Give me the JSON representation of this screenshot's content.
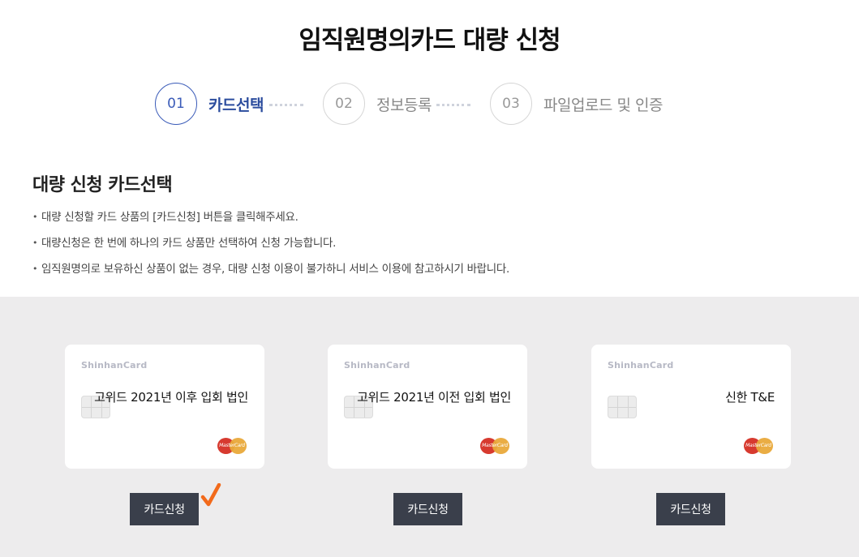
{
  "page": {
    "title": "임직원명의카드 대량 신청"
  },
  "steps": [
    {
      "number": "01",
      "label": "카드선택",
      "active": true
    },
    {
      "number": "02",
      "label": "정보등록",
      "active": false
    },
    {
      "number": "03",
      "label": "파일업로드 및 인증",
      "active": false
    }
  ],
  "section": {
    "title": "대량 신청 카드선택",
    "guides": [
      "대량 신청할 카드 상품의 [카드신청] 버튼을 클릭해주세요.",
      "대량신청은 한 번에 하나의 카드 상품만 선택하여 신청 가능합니다.",
      "임직원명의로 보유하신 상품이 없는 경우, 대량 신청 이용이 불가하니 서비스 이용에 참고하시기 바랍니다."
    ]
  },
  "cards": [
    {
      "brand": "ShinhanCard",
      "name": "고위드 2021년 이후 입회 법인",
      "network": "MasterCard",
      "button_label": "카드신청"
    },
    {
      "brand": "ShinhanCard",
      "name": "고위드 2021년 이전 입회 법인",
      "network": "MasterCard",
      "button_label": "카드신청"
    },
    {
      "brand": "ShinhanCard",
      "name": "신한 T&E",
      "network": "MasterCard",
      "button_label": "카드신청"
    }
  ],
  "icons": {
    "chip": "card-chip-icon",
    "network": "mastercard-logo-icon",
    "annotation": "check-mark-icon"
  },
  "colors": {
    "accent": "#3a5bb8",
    "button_bg": "#3a3f4b",
    "card_area_bg": "#edeced",
    "check_mark": "#f26a1b"
  }
}
